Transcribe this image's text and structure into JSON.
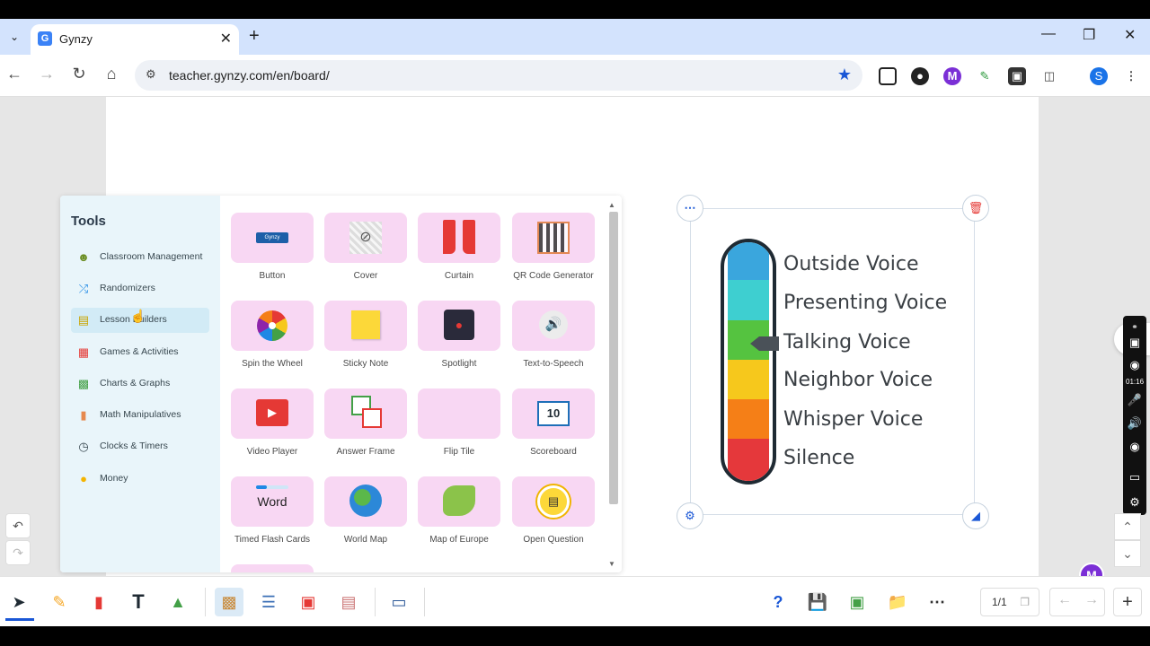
{
  "browser": {
    "tab_title": "Gynzy",
    "tab_favicon": "G",
    "url": "teacher.gynzy.com/en/board/",
    "profile_initial": "S"
  },
  "tools": {
    "title": "Tools",
    "categories": [
      {
        "label": "Classroom Management",
        "icon": "classroom-icon",
        "selected": false
      },
      {
        "label": "Randomizers",
        "icon": "shuffle-icon",
        "selected": false
      },
      {
        "label": "Lesson Builders",
        "icon": "lesson-icon",
        "selected": true
      },
      {
        "label": "Games & Activities",
        "icon": "games-icon",
        "selected": false
      },
      {
        "label": "Charts & Graphs",
        "icon": "chart-icon",
        "selected": false
      },
      {
        "label": "Math Manipulatives",
        "icon": "ruler-icon",
        "selected": false
      },
      {
        "label": "Clocks & Timers",
        "icon": "clock-icon",
        "selected": false
      },
      {
        "label": "Money",
        "icon": "coins-icon",
        "selected": false
      }
    ],
    "items": [
      {
        "label": "Button",
        "icon": "button-icon",
        "badge": "Gynzy"
      },
      {
        "label": "Cover",
        "icon": "cover-icon"
      },
      {
        "label": "Curtain",
        "icon": "curtain-icon"
      },
      {
        "label": "QR Code Generator",
        "icon": "qr-code-icon"
      },
      {
        "label": "Spin the Wheel",
        "icon": "wheel-icon"
      },
      {
        "label": "Sticky Note",
        "icon": "sticky-note-icon"
      },
      {
        "label": "Spotlight",
        "icon": "spotlight-icon"
      },
      {
        "label": "Text-to-Speech",
        "icon": "speaker-icon"
      },
      {
        "label": "Video Player",
        "icon": "video-icon"
      },
      {
        "label": "Answer Frame",
        "icon": "answer-frame-icon"
      },
      {
        "label": "Flip Tile",
        "icon": "flip-tile-icon"
      },
      {
        "label": "Scoreboard",
        "icon": "scoreboard-icon",
        "badge": "10"
      },
      {
        "label": "Timed Flash Cards",
        "icon": "flash-cards-icon",
        "badge": "Word"
      },
      {
        "label": "World Map",
        "icon": "globe-icon"
      },
      {
        "label": "Map of Europe",
        "icon": "europe-map-icon"
      },
      {
        "label": "Open Question",
        "icon": "question-icon"
      }
    ]
  },
  "voice_meter": {
    "levels": [
      {
        "label": "Outside Voice",
        "color": "#3aa6dd"
      },
      {
        "label": "Presenting Voice",
        "color": "#3ecfd0"
      },
      {
        "label": "Talking Voice",
        "color": "#55c340"
      },
      {
        "label": "Neighbor Voice",
        "color": "#f6c81c"
      },
      {
        "label": "Whisper Voice",
        "color": "#f57f17"
      },
      {
        "label": "Silence",
        "color": "#e5383b"
      }
    ],
    "current_level": "Talking Voice"
  },
  "recorder": {
    "timer": "01:16"
  },
  "pagination": {
    "indicator": "1/1"
  },
  "colors": {
    "tile_bg": "#f8d7f3",
    "side_bg": "#e9f5fa",
    "accent": "#1a57d6"
  }
}
